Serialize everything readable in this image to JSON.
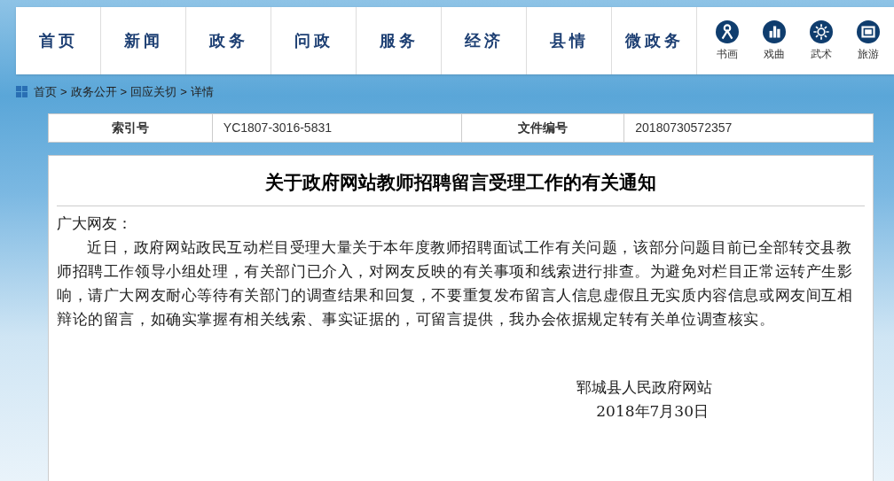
{
  "nav": {
    "items": [
      {
        "label": "首页"
      },
      {
        "label": "新闻"
      },
      {
        "label": "政务"
      },
      {
        "label": "问政"
      },
      {
        "label": "服务"
      },
      {
        "label": "经济"
      },
      {
        "label": "县情"
      },
      {
        "label": "微政务"
      }
    ],
    "icon_links": [
      {
        "label": "书画",
        "kind": "person"
      },
      {
        "label": "戏曲",
        "kind": "buildings"
      },
      {
        "label": "武术",
        "kind": "sun"
      },
      {
        "label": "旅游",
        "kind": "photo"
      }
    ]
  },
  "breadcrumb": [
    "首页",
    "政务公开",
    "回应关切",
    "详情"
  ],
  "breadcrumb_separator": ">",
  "info_table": [
    {
      "label": "索引号",
      "value": "YC1807-3016-5831"
    },
    {
      "label": "文件编号",
      "value": "20180730572357"
    }
  ],
  "article": {
    "title": "关于政府网站教师招聘留言受理工作的有关通知",
    "salutation": "广大网友：",
    "paragraphs": [
      "近日，政府网站政民互动栏目受理大量关于本年度教师招聘面试工作有关问题，该部分问题目前已全部转交县教师招聘工作领导小组处理，有关部门已介入，对网友反映的有关事项和线索进行排查。为避免对栏目正常运转产生影响，请广大网友耐心等待有关部门的调查结果和回复，不要重复发布留言人信息虚假且无实质内容信息或网友间互相辩论的留言，如确实掌握有相关线索、事实证据的，可留言提供，我办会依据规定转有关单位调查核实。"
    ],
    "signature": "郓城县人民政府网站",
    "date": "2018年7月30日"
  }
}
